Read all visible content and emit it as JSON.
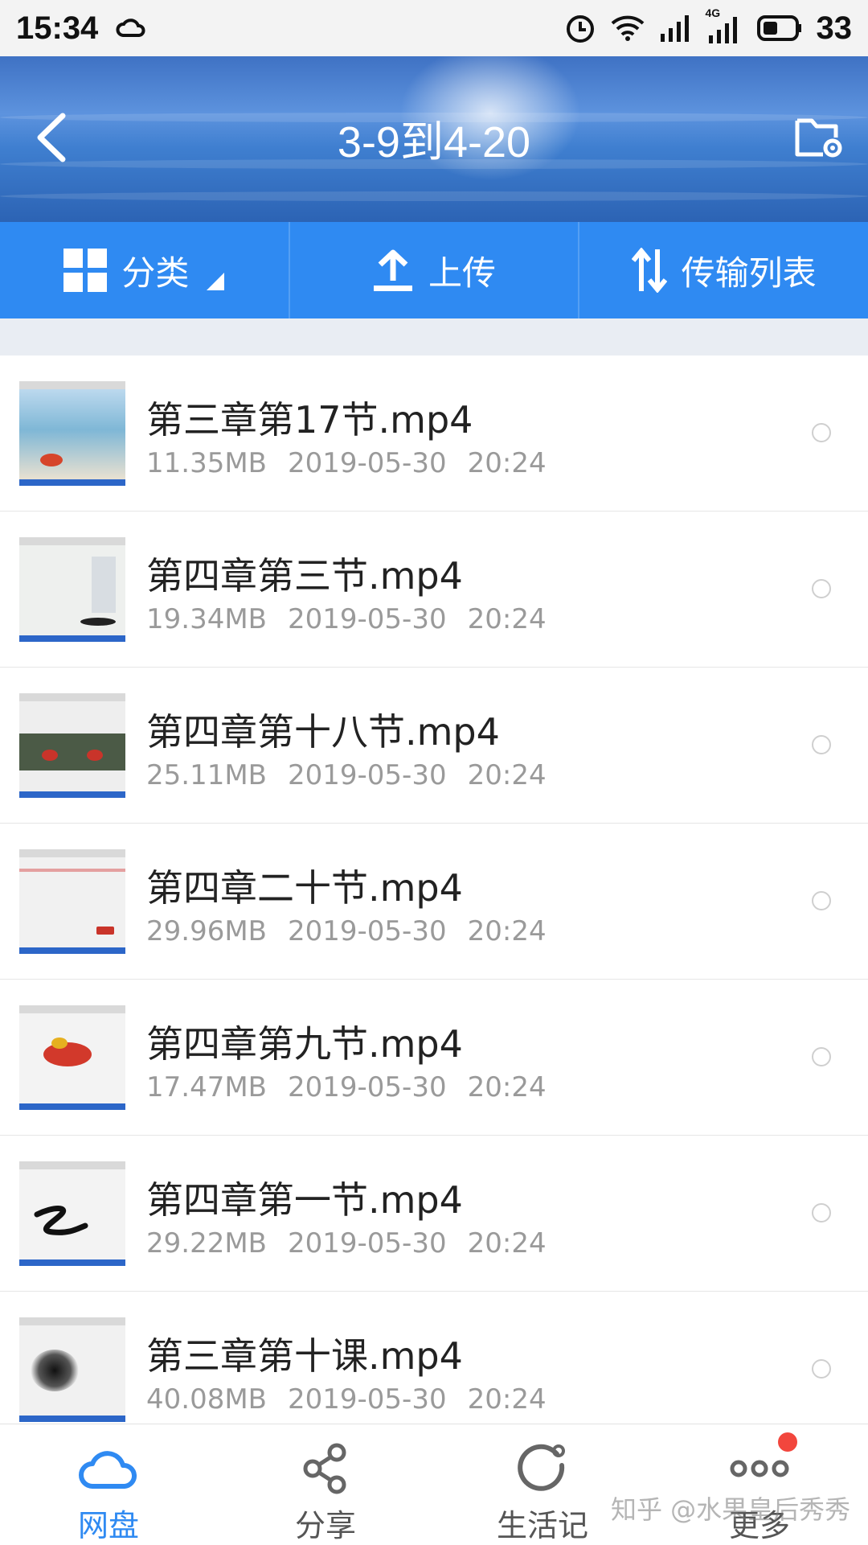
{
  "status_bar": {
    "time": "15:34",
    "network": "4G",
    "battery": "33",
    "icons": [
      "cloud-sync-icon",
      "alarm-icon",
      "wifi-icon",
      "signal-icon",
      "4g-signal-icon",
      "battery-icon"
    ]
  },
  "header": {
    "title": "3-9到4-20",
    "back_icon": "chevron-left-icon",
    "folder_icon": "folder-settings-icon"
  },
  "toolbar": {
    "category_label": "分类",
    "upload_label": "上传",
    "transfer_label": "传输列表"
  },
  "files": [
    {
      "name": "第三章第17节.mp4",
      "size": "11.35MB",
      "date": "2019-05-30",
      "time": "20:24"
    },
    {
      "name": "第四章第三节.mp4",
      "size": "19.34MB",
      "date": "2019-05-30",
      "time": "20:24"
    },
    {
      "name": "第四章第十八节.mp4",
      "size": "25.11MB",
      "date": "2019-05-30",
      "time": "20:24"
    },
    {
      "name": "第四章二十节.mp4",
      "size": "29.96MB",
      "date": "2019-05-30",
      "time": "20:24"
    },
    {
      "name": "第四章第九节.mp4",
      "size": "17.47MB",
      "date": "2019-05-30",
      "time": "20:24"
    },
    {
      "name": "第四章第一节.mp4",
      "size": "29.22MB",
      "date": "2019-05-30",
      "time": "20:24"
    },
    {
      "name": "第三章第十课.mp4",
      "size": "40.08MB",
      "date": "2019-05-30",
      "time": "20:24"
    }
  ],
  "bottom_nav": {
    "items": [
      {
        "label": "网盘",
        "icon": "cloud-icon"
      },
      {
        "label": "分享",
        "icon": "share-icon"
      },
      {
        "label": "生活记",
        "icon": "refresh-circle-icon"
      },
      {
        "label": "更多",
        "icon": "more-dots-icon"
      }
    ]
  },
  "watermark": "知乎 @水果皇后秀秀",
  "colors": {
    "accent": "#2f8af2",
    "badge": "#f2463d"
  }
}
